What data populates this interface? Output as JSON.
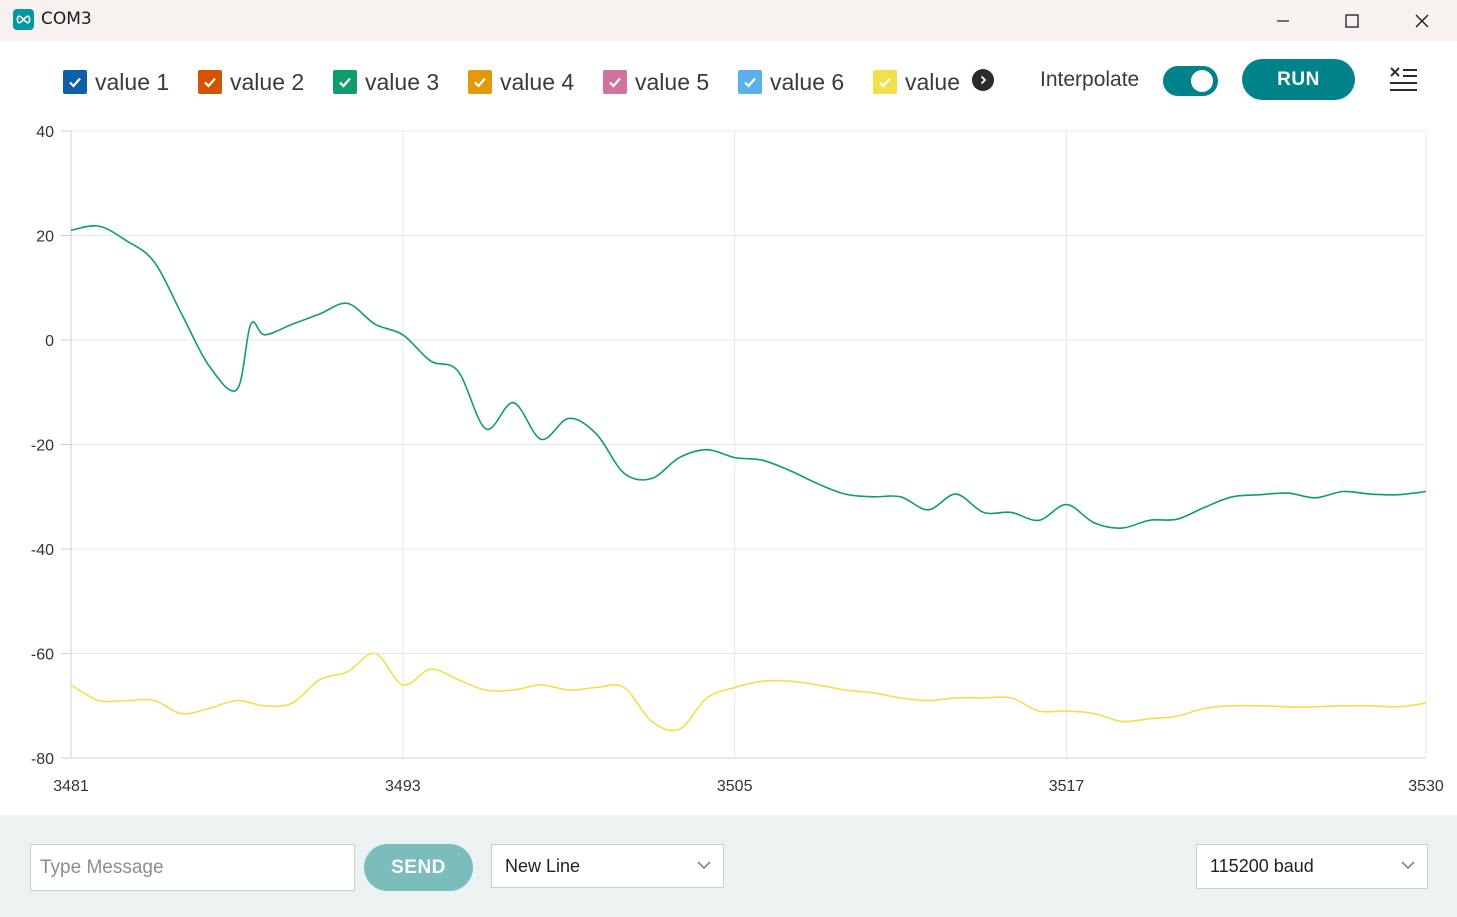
{
  "window": {
    "title": "COM3",
    "app_icon": "arduino-infinity-icon"
  },
  "toolbar": {
    "legend": [
      {
        "label": "value 1",
        "color": "#0e5fa8",
        "checked": true
      },
      {
        "label": "value 2",
        "color": "#d35400",
        "checked": true
      },
      {
        "label": "value 3",
        "color": "#0f9d6b",
        "checked": true
      },
      {
        "label": "value 4",
        "color": "#e39a09",
        "checked": true
      },
      {
        "label": "value 5",
        "color": "#d0739f",
        "checked": true
      },
      {
        "label": "value 6",
        "color": "#5ab0e8",
        "checked": true
      },
      {
        "label": "value",
        "color": "#f0e04a",
        "checked": true
      }
    ],
    "more_icon": "chevron-right-icon",
    "interpolate_label": "Interpolate",
    "interpolate_on": true,
    "run_label": "RUN",
    "clear_icon": "clear-list-icon",
    "accent": "#00828a"
  },
  "chart_data": {
    "type": "line",
    "xlim": [
      3481,
      3530
    ],
    "ylim": [
      -80,
      40
    ],
    "x_ticks": [
      "3481",
      "3493",
      "3505",
      "3517",
      "3530"
    ],
    "y_ticks": [
      "40",
      "20",
      "0",
      "-20",
      "-40",
      "-60",
      "-80"
    ],
    "grid": true,
    "series": [
      {
        "name": "value 3",
        "color": "#0f9d6b",
        "x": [
          3481,
          3482,
          3483,
          3484,
          3485,
          3486,
          3487,
          3487.5,
          3488,
          3489,
          3490,
          3491,
          3492,
          3493,
          3494,
          3495,
          3496,
          3497,
          3498,
          3499,
          3500,
          3501,
          3502,
          3503,
          3504,
          3505,
          3506,
          3507,
          3508,
          3509,
          3510,
          3511,
          3512,
          3513,
          3514,
          3515,
          3516,
          3517,
          3518,
          3519,
          3520,
          3521,
          3522,
          3523,
          3524,
          3525,
          3526,
          3527,
          3528,
          3529,
          3530
        ],
        "y": [
          21,
          21.8,
          19,
          15,
          5,
          -5,
          -9.5,
          3,
          1,
          3,
          5,
          7,
          3,
          1,
          -4,
          -6,
          -17,
          -12,
          -19,
          -15,
          -18,
          -25.5,
          -26.5,
          -22.5,
          -21,
          -22.5,
          -23,
          -25,
          -27.5,
          -29.5,
          -30,
          -30,
          -32.5,
          -29.5,
          -33,
          -33,
          -34.5,
          -31.5,
          -35,
          -36,
          -34.5,
          -34.3,
          -32,
          -30,
          -29.6,
          -29.3,
          -30.2,
          -29,
          -29.5,
          -29.6,
          -29
        ]
      },
      {
        "name": "value",
        "color": "#f0e04a",
        "x": [
          3481,
          3482,
          3483,
          3484,
          3485,
          3486,
          3487,
          3488,
          3489,
          3490,
          3491,
          3492,
          3493,
          3494,
          3495,
          3496,
          3497,
          3498,
          3499,
          3500,
          3501,
          3502,
          3503,
          3504,
          3505,
          3506,
          3507,
          3508,
          3509,
          3510,
          3511,
          3512,
          3513,
          3514,
          3515,
          3516,
          3517,
          3518,
          3519,
          3520,
          3521,
          3522,
          3523,
          3524,
          3525,
          3526,
          3527,
          3528,
          3529,
          3530
        ],
        "y": [
          -66,
          -69,
          -69,
          -69,
          -71.5,
          -70.5,
          -69,
          -70,
          -69.5,
          -65,
          -63.5,
          -60,
          -66,
          -63,
          -65,
          -67,
          -67,
          -66,
          -67,
          -66.5,
          -66.5,
          -73,
          -74.5,
          -68.5,
          -66.5,
          -65.3,
          -65.3,
          -66,
          -67,
          -67.5,
          -68.5,
          -69,
          -68.5,
          -68.5,
          -68.5,
          -71,
          -71,
          -71.5,
          -73,
          -72.5,
          -72,
          -70.5,
          -70,
          -70,
          -70.2,
          -70.2,
          -70,
          -70,
          -70.2,
          -69.5
        ]
      }
    ]
  },
  "footer": {
    "message_placeholder": "Type Message",
    "message_value": "",
    "send_label": "SEND",
    "line_ending": "New Line",
    "baud": "115200 baud"
  }
}
